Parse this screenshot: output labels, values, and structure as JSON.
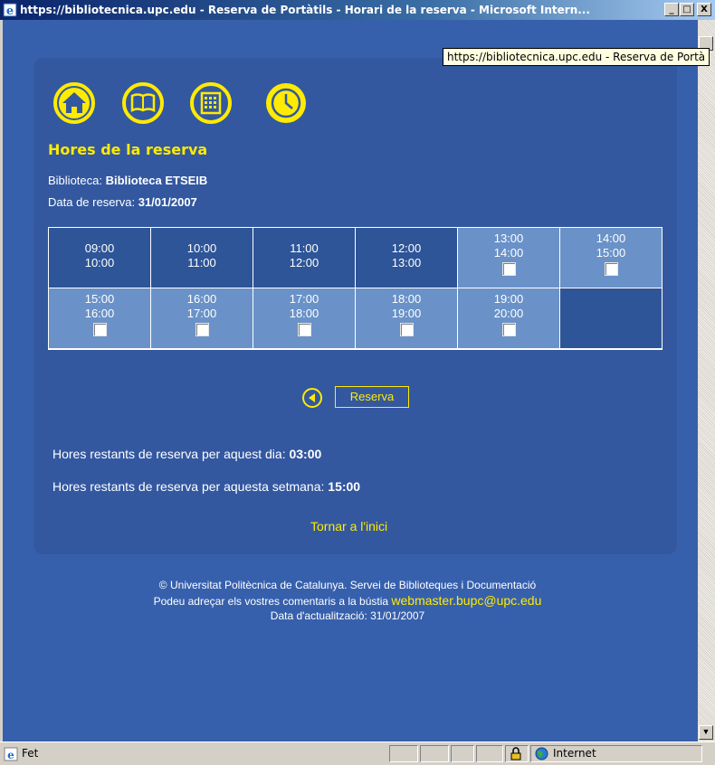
{
  "window": {
    "title": "https://bibliotecnica.upc.edu - Reserva de Portàtils - Horari de la reserva - Microsoft Intern...",
    "tooltip": "https://bibliotecnica.upc.edu - Reserva de Portà",
    "buttons": [
      "_",
      "□",
      "X"
    ]
  },
  "nav_icons": [
    "home-icon",
    "book-icon",
    "calendar-icon",
    "clock-icon"
  ],
  "heading": "Hores de la reserva",
  "library": {
    "label": "Biblioteca: ",
    "value": "Biblioteca ETSEIB"
  },
  "date": {
    "label": "Data de reserva: ",
    "value": "31/01/2007"
  },
  "slots": [
    {
      "start": "09:00",
      "end": "10:00",
      "available": false
    },
    {
      "start": "10:00",
      "end": "11:00",
      "available": false
    },
    {
      "start": "11:00",
      "end": "12:00",
      "available": false
    },
    {
      "start": "12:00",
      "end": "13:00",
      "available": false
    },
    {
      "start": "13:00",
      "end": "14:00",
      "available": true
    },
    {
      "start": "14:00",
      "end": "15:00",
      "available": true
    },
    {
      "start": "15:00",
      "end": "16:00",
      "available": true
    },
    {
      "start": "16:00",
      "end": "17:00",
      "available": true
    },
    {
      "start": "17:00",
      "end": "18:00",
      "available": true
    },
    {
      "start": "18:00",
      "end": "19:00",
      "available": true
    },
    {
      "start": "19:00",
      "end": "20:00",
      "available": true
    }
  ],
  "reserve_button": "Reserva",
  "remaining_day": {
    "label": "Hores restants de reserva per aquest dia: ",
    "value": "03:00"
  },
  "remaining_week": {
    "label": "Hores restants de reserva per aquesta setmana: ",
    "value": "15:00"
  },
  "back_link": "Tornar a l'inici",
  "footer": {
    "copyright": "© Universitat Politècnica de Catalunya. Servei de Biblioteques i Documentació",
    "comments": "Podeu adreçar els vostres comentaris a la bústia",
    "email": "webmaster.bupc@upc.edu",
    "updated": "Data d'actualització: 31/01/2007"
  },
  "statusbar": {
    "text": "Fet",
    "zone": "Internet"
  },
  "colors": {
    "accent": "#ffeb00",
    "background": "#3760ac",
    "panel": "#3358a0",
    "slot_free": "#6a92c8",
    "slot_taken": "#2e5597"
  }
}
